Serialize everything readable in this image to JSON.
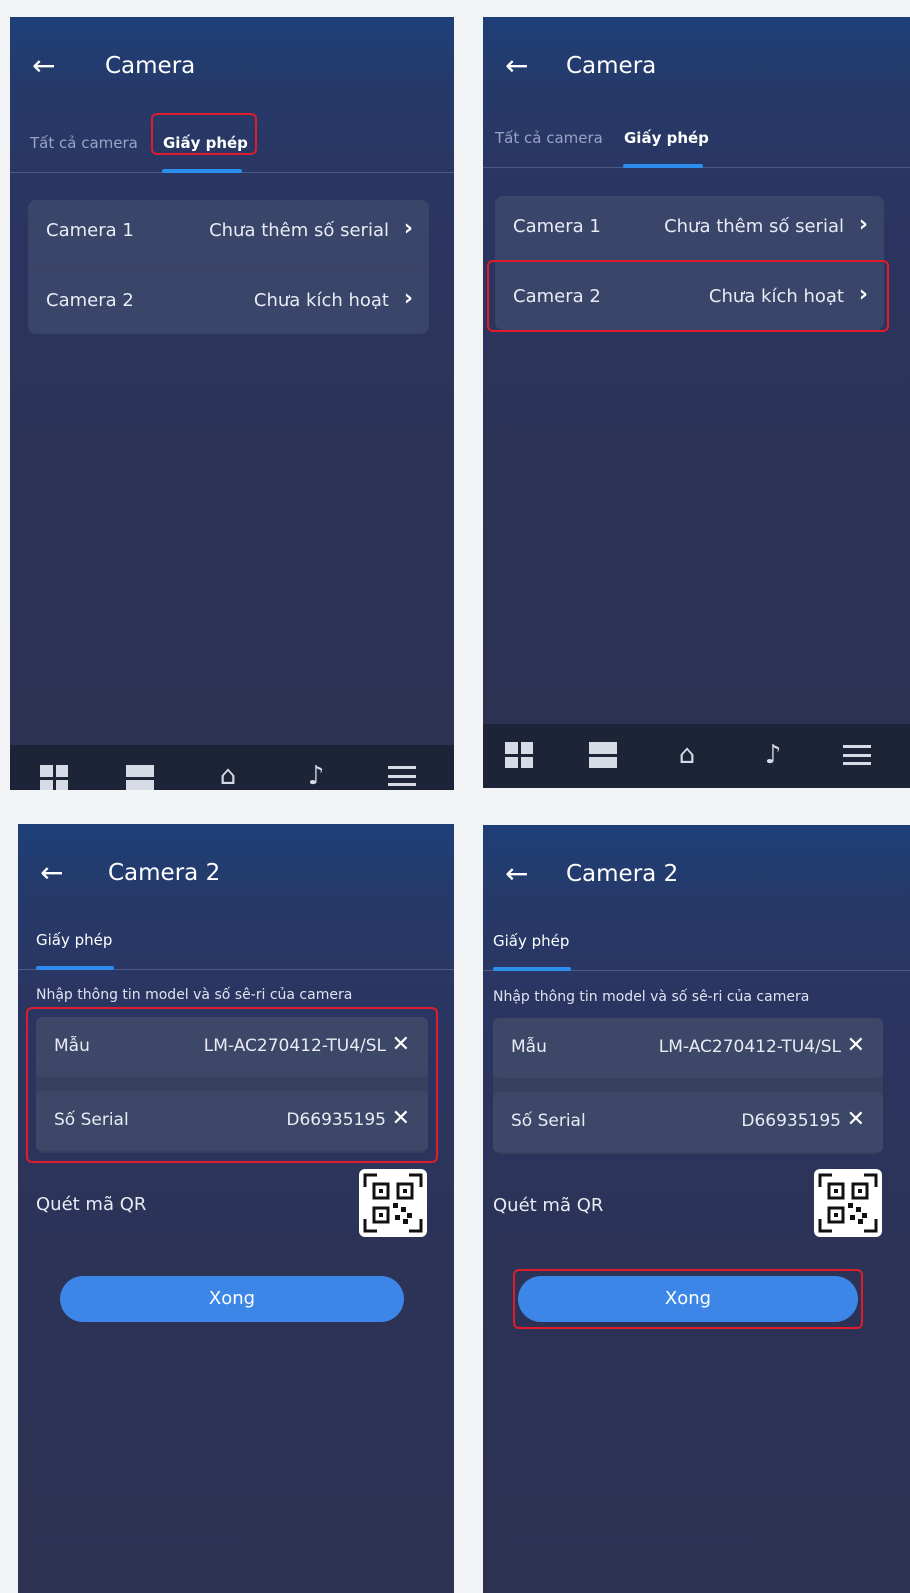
{
  "icons": {
    "back": "←",
    "chevron": "›",
    "clear": "✕",
    "home": "⌂",
    "music": "♪"
  },
  "screen1": {
    "title": "Camera",
    "tabs": [
      {
        "label": "Tất cả camera"
      },
      {
        "label": "Giấy phép"
      }
    ],
    "list": [
      {
        "label": "Camera 1",
        "value": "Chưa thêm số serial"
      },
      {
        "label": "Camera 2",
        "value": "Chưa kích hoạt"
      }
    ]
  },
  "screen2": {
    "title": "Camera",
    "tabs": [
      {
        "label": "Tất cả camera"
      },
      {
        "label": "Giấy phép"
      }
    ],
    "list": [
      {
        "label": "Camera 1",
        "value": "Chưa thêm số serial"
      },
      {
        "label": "Camera 2",
        "value": "Chưa kích hoạt"
      }
    ]
  },
  "screen3": {
    "title": "Camera 2",
    "tab": "Giấy phép",
    "hint": "Nhập thông tin model và số sê-ri của camera",
    "model_label": "Mẫu",
    "model_value": "LM-AC270412-TU4/SL",
    "serial_label": "Số Serial",
    "serial_value": "D66935195",
    "qr_label": "Quét mã QR",
    "done_label": "Xong"
  },
  "screen4": {
    "title": "Camera 2",
    "tab": "Giấy phép",
    "hint": "Nhập thông tin model và số sê-ri của camera",
    "model_label": "Mẫu",
    "model_value": "LM-AC270412-TU4/SL",
    "serial_label": "Số Serial",
    "serial_value": "D66935195",
    "qr_label": "Quét mã QR",
    "done_label": "Xong"
  },
  "colors": {
    "highlight": "#e01b2b",
    "accent": "#2d8ef0",
    "button": "#3b86e6"
  }
}
